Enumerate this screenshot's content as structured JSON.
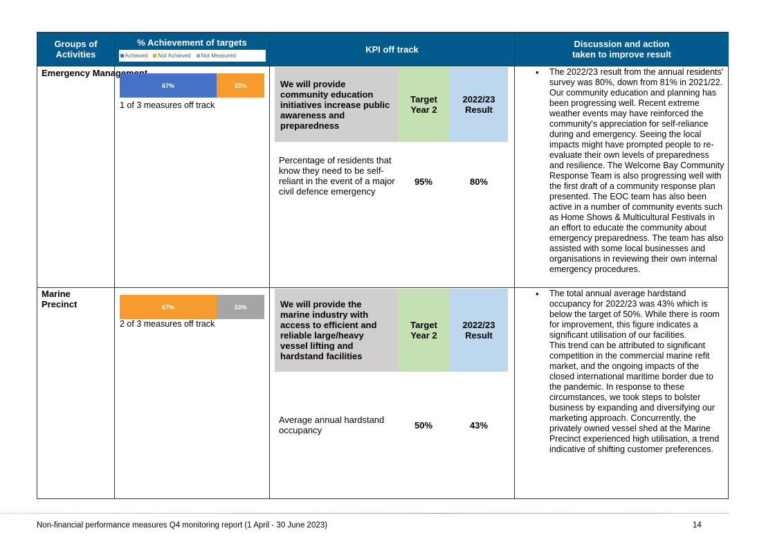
{
  "header": {
    "col1": "Groups of Activities",
    "col2": "% Achievement of targets",
    "col3": "KPI off track",
    "col4_line1": "Discussion and action",
    "col4_line2": "taken to improve result",
    "legend": {
      "achieved": "Achieved",
      "not_achieved": "Not Achieved",
      "not_measured": "Not Measured"
    }
  },
  "colors": {
    "header_bg": "#005a8b",
    "achieved": "#4472c4",
    "not_achieved": "#f79b2e",
    "not_measured": "#a5a5a5",
    "kpi_title_bg": "#d0cece",
    "target_bg": "#c5e0b3",
    "result_bg": "#bdd7ee"
  },
  "rows": [
    {
      "group": "Emergency Management",
      "bar": [
        {
          "label": "67%",
          "value": 67,
          "category": "achieved"
        },
        {
          "label": "33%",
          "value": 33,
          "category": "not_achieved"
        }
      ],
      "measures_off_track": "1 of 3 measures off track",
      "kpi_title": "We will provide community education initiatives increase public awareness and preparedness",
      "target_label": "Target Year 2",
      "result_label": "2022/23 Result",
      "kpi_desc": "Percentage of residents that know they need to be self-reliant in the event of a major civil defence emergency",
      "target_value": "95%",
      "result_value": "80%",
      "discussion": "The 2022/23 result from the annual residents' survey was 80%, down from 81% in 2021/22. Our community education and planning has been progressing well. Recent extreme weather events may have reinforced the community's appreciation for self-reliance during and emergency. Seeing the local impacts might have prompted people to re-evaluate their own levels of preparedness and resilience. The Welcome Bay Community Response Team is also progressing well with the first draft of a community response plan presented. The EOC team has also been active in a number of community events such as Home Shows & Multicultural Festivals in an effort to educate the community about emergency preparedness. The team has also assisted with some local businesses and organisations in reviewing their own internal emergency procedures."
    },
    {
      "group": "Marine Precinct",
      "bar": [
        {
          "label": "67%",
          "value": 67,
          "category": "not_achieved"
        },
        {
          "label": "33%",
          "value": 33,
          "category": "not_measured"
        }
      ],
      "measures_off_track": "2 of 3 measures off track",
      "kpi_title": "We will provide the marine industry with access to efficient and reliable large/heavy vessel lifting and hardstand facilities",
      "target_label": "Target Year 2",
      "result_label": "2022/23 Result",
      "kpi_desc": "Average annual hardstand occupancy",
      "target_value": "50%",
      "result_value": "43%",
      "discussion": "The total annual average hardstand occupancy for 2022/23 was 43% which is below the target of 50%. While there is room for improvement, this figure indicates a significant utilisation of our facilities.\nThis trend can be attributed to significant competition in the commercial marine refit market, and the ongoing impacts of the closed international maritime border due to the pandemic. In response to these circumstances, we took steps to bolster business by expanding and diversifying our marketing approach. Concurrently, the privately owned vessel shed at the Marine Precinct experienced high utilisation, a trend indicative of shifting customer preferences."
    }
  ],
  "footer": {
    "text": "Non-financial performance measures Q4 monitoring report (1 April - 30 June 2023)",
    "page": "14"
  }
}
